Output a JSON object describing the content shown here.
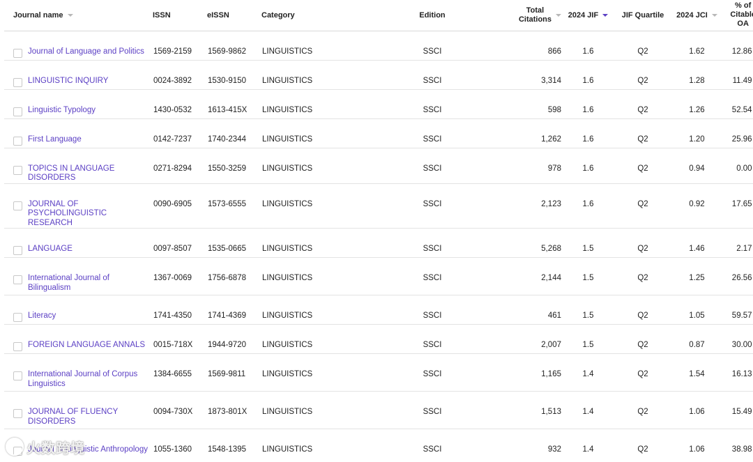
{
  "table": {
    "headers": {
      "journal_name": "Journal name",
      "issn": "ISSN",
      "eissn": "eISSN",
      "category": "Category",
      "edition": "Edition",
      "total_citations_line1": "Total",
      "total_citations_line2": "Citations",
      "jif": "2024 JIF",
      "jif_quartile": "JIF Quartile",
      "jci": "2024 JCI",
      "oa_line1": "% of",
      "oa_line2": "Citable",
      "oa_line3": "OA"
    },
    "sorted_column": "2024 JIF",
    "rows": [
      {
        "name": "Journal of Language and Politics",
        "issn": "1569-2159",
        "eissn": "1569-9862",
        "category": "LINGUISTICS",
        "edition": "SSCI",
        "citations": "866",
        "jif": "1.6",
        "quartile": "Q2",
        "jci": "1.62",
        "oa": "12.86 %"
      },
      {
        "name": "LINGUISTIC INQUIRY",
        "issn": "0024-3892",
        "eissn": "1530-9150",
        "category": "LINGUISTICS",
        "edition": "SSCI",
        "citations": "3,314",
        "jif": "1.6",
        "quartile": "Q2",
        "jci": "1.28",
        "oa": "11.49 %"
      },
      {
        "name": "Linguistic Typology",
        "issn": "1430-0532",
        "eissn": "1613-415X",
        "category": "LINGUISTICS",
        "edition": "SSCI",
        "citations": "598",
        "jif": "1.6",
        "quartile": "Q2",
        "jci": "1.26",
        "oa": "52.54 %"
      },
      {
        "name": "First Language",
        "issn": "0142-7237",
        "eissn": "1740-2344",
        "category": "LINGUISTICS",
        "edition": "SSCI",
        "citations": "1,262",
        "jif": "1.6",
        "quartile": "Q2",
        "jci": "1.20",
        "oa": "25.96 %"
      },
      {
        "name": "TOPICS IN LANGUAGE DISORDERS",
        "issn": "0271-8294",
        "eissn": "1550-3259",
        "category": "LINGUISTICS",
        "edition": "SSCI",
        "citations": "978",
        "jif": "1.6",
        "quartile": "Q2",
        "jci": "0.94",
        "oa": "0.00 %"
      },
      {
        "name": "JOURNAL OF PSYCHOLINGUISTIC RESEARCH",
        "issn": "0090-6905",
        "eissn": "1573-6555",
        "category": "LINGUISTICS",
        "edition": "SSCI",
        "citations": "2,123",
        "jif": "1.6",
        "quartile": "Q2",
        "jci": "0.92",
        "oa": "17.65 %"
      },
      {
        "name": "LANGUAGE",
        "issn": "0097-8507",
        "eissn": "1535-0665",
        "category": "LINGUISTICS",
        "edition": "SSCI",
        "citations": "5,268",
        "jif": "1.5",
        "quartile": "Q2",
        "jci": "1.46",
        "oa": "2.17 %"
      },
      {
        "name": "International Journal of Bilingualism",
        "issn": "1367-0069",
        "eissn": "1756-6878",
        "category": "LINGUISTICS",
        "edition": "SSCI",
        "citations": "2,144",
        "jif": "1.5",
        "quartile": "Q2",
        "jci": "1.25",
        "oa": "26.56 %"
      },
      {
        "name": "Literacy",
        "issn": "1741-4350",
        "eissn": "1741-4369",
        "category": "LINGUISTICS",
        "edition": "SSCI",
        "citations": "461",
        "jif": "1.5",
        "quartile": "Q2",
        "jci": "1.05",
        "oa": "59.57 %"
      },
      {
        "name": "FOREIGN LANGUAGE ANNALS",
        "issn": "0015-718X",
        "eissn": "1944-9720",
        "category": "LINGUISTICS",
        "edition": "SSCI",
        "citations": "2,007",
        "jif": "1.5",
        "quartile": "Q2",
        "jci": "0.87",
        "oa": "30.00 %"
      },
      {
        "name": "International Journal of Corpus Linguistics",
        "issn": "1384-6655",
        "eissn": "1569-9811",
        "category": "LINGUISTICS",
        "edition": "SSCI",
        "citations": "1,165",
        "jif": "1.4",
        "quartile": "Q2",
        "jci": "1.54",
        "oa": "16.13 %"
      },
      {
        "name": "JOURNAL OF FLUENCY DISORDERS",
        "issn": "0094-730X",
        "eissn": "1873-801X",
        "category": "LINGUISTICS",
        "edition": "SSCI",
        "citations": "1,513",
        "jif": "1.4",
        "quartile": "Q2",
        "jci": "1.06",
        "oa": "15.49 %"
      },
      {
        "name": "Journal of Linguistic Anthropology",
        "issn": "1055-1360",
        "eissn": "1548-1395",
        "category": "LINGUISTICS",
        "edition": "SSCI",
        "citations": "932",
        "jif": "1.4",
        "quartile": "Q2",
        "jci": "1.06",
        "oa": "38.98 %"
      }
    ]
  },
  "watermark": {
    "text": "火数跨境"
  },
  "colors": {
    "link": "#5b3fc4",
    "sort_active": "#5b3fc4",
    "border": "#e3e3e3"
  }
}
